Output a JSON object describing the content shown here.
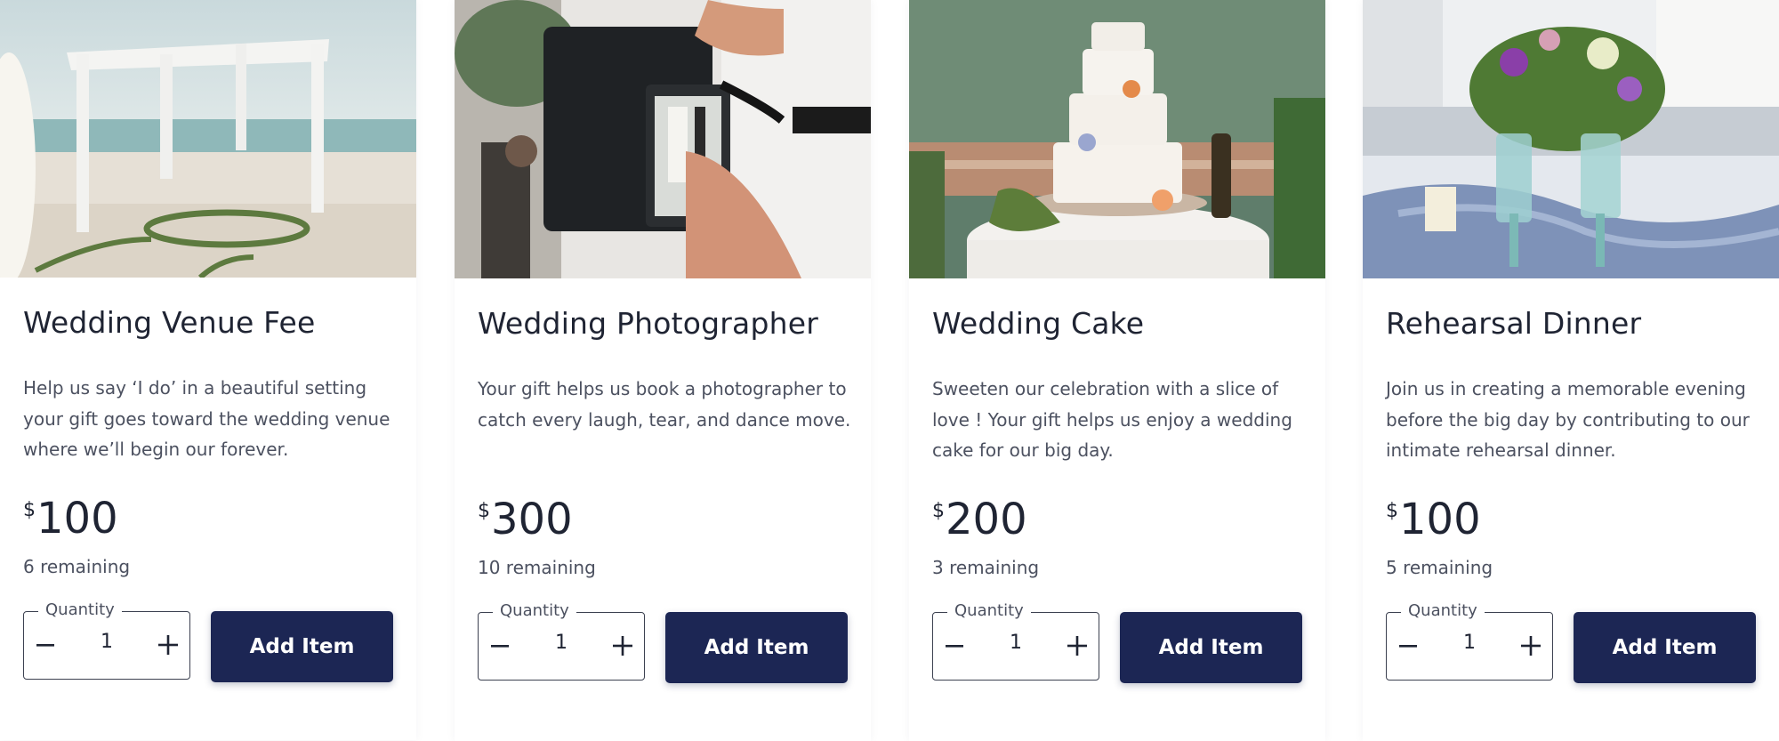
{
  "gifts": [
    {
      "image": "beach-wedding-arch-photo",
      "title": "Wedding Venue Fee",
      "description": "Help us say ‘I do’ in a beautiful setting your gift goes toward the wedding venue where we’ll begin our forever.",
      "currency": "$",
      "price": "100",
      "remaining": "6 remaining",
      "quantity_label": "Quantity",
      "quantity": "1",
      "button": "Add Item"
    },
    {
      "image": "camera-photographer-photo",
      "title": "Wedding Photographer",
      "description": "Your gift helps us book a photographer to catch every laugh, tear, and dance move.",
      "currency": "$",
      "price": "300",
      "remaining": "10 remaining",
      "quantity_label": "Quantity",
      "quantity": "1",
      "button": "Add Item"
    },
    {
      "image": "wedding-cake-photo",
      "title": "Wedding Cake",
      "description": "Sweeten our celebration with a slice of love ! Your gift helps us enjoy a wedding cake for our big day.",
      "currency": "$",
      "price": "200",
      "remaining": "3 remaining",
      "quantity_label": "Quantity",
      "quantity": "1",
      "button": "Add Item"
    },
    {
      "image": "rehearsal-table-photo",
      "title": "Rehearsal Dinner",
      "description": "Join us in creating a memorable evening before the big day by contributing to our intimate rehearsal dinner.",
      "currency": "$",
      "price": "100",
      "remaining": "5 remaining",
      "quantity_label": "Quantity",
      "quantity": "1",
      "button": "Add Item"
    }
  ],
  "colors": {
    "button_bg": "#1c2654",
    "text": "#1f2433",
    "muted": "#4c5160"
  },
  "icons": {
    "decrement": "minus-icon",
    "increment": "plus-icon"
  }
}
